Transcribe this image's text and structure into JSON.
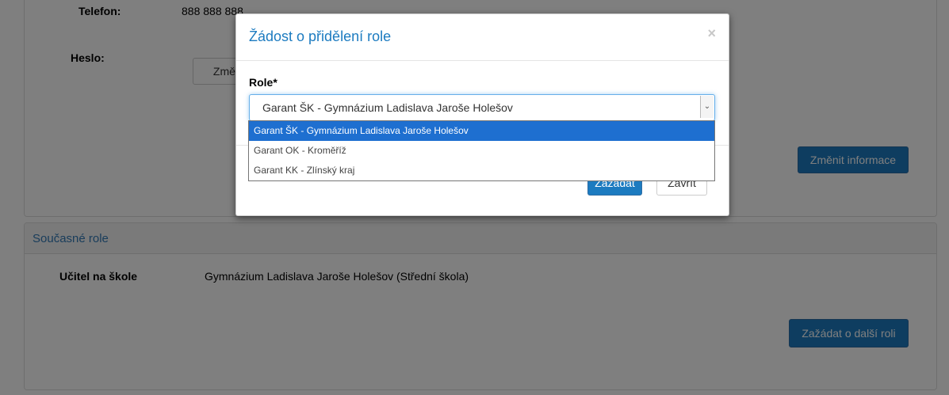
{
  "profile": {
    "phone_label": "Telefon:",
    "phone_value": "888 888 888",
    "password_label": "Heslo:",
    "change_password_button": "Změnit heslo",
    "change_info_button": "Změnit informace"
  },
  "current_roles": {
    "title": "Současné role",
    "role_label": "Učitel na škole",
    "role_value": "Gymnázium Ladislava Jaroše Holešov (Střední škola)",
    "request_button": "Zažádat o další roli"
  },
  "modal": {
    "title": "Žádost o přidělení role",
    "close_glyph": "×",
    "role_field_label": "Role*",
    "selected_value": "Garant ŠK - Gymnázium Ladislava Jaroše Holešov",
    "options": [
      "Garant ŠK - Gymnázium Ladislava Jaroše Holešov",
      "Garant OK - Kroměříž",
      "Garant KK - Zlínský kraj"
    ],
    "submit_button": "Zažádat",
    "close_button": "Zavřít"
  },
  "colors": {
    "accent": "#1c7bc0",
    "selected_option": "#1e6fd0"
  }
}
